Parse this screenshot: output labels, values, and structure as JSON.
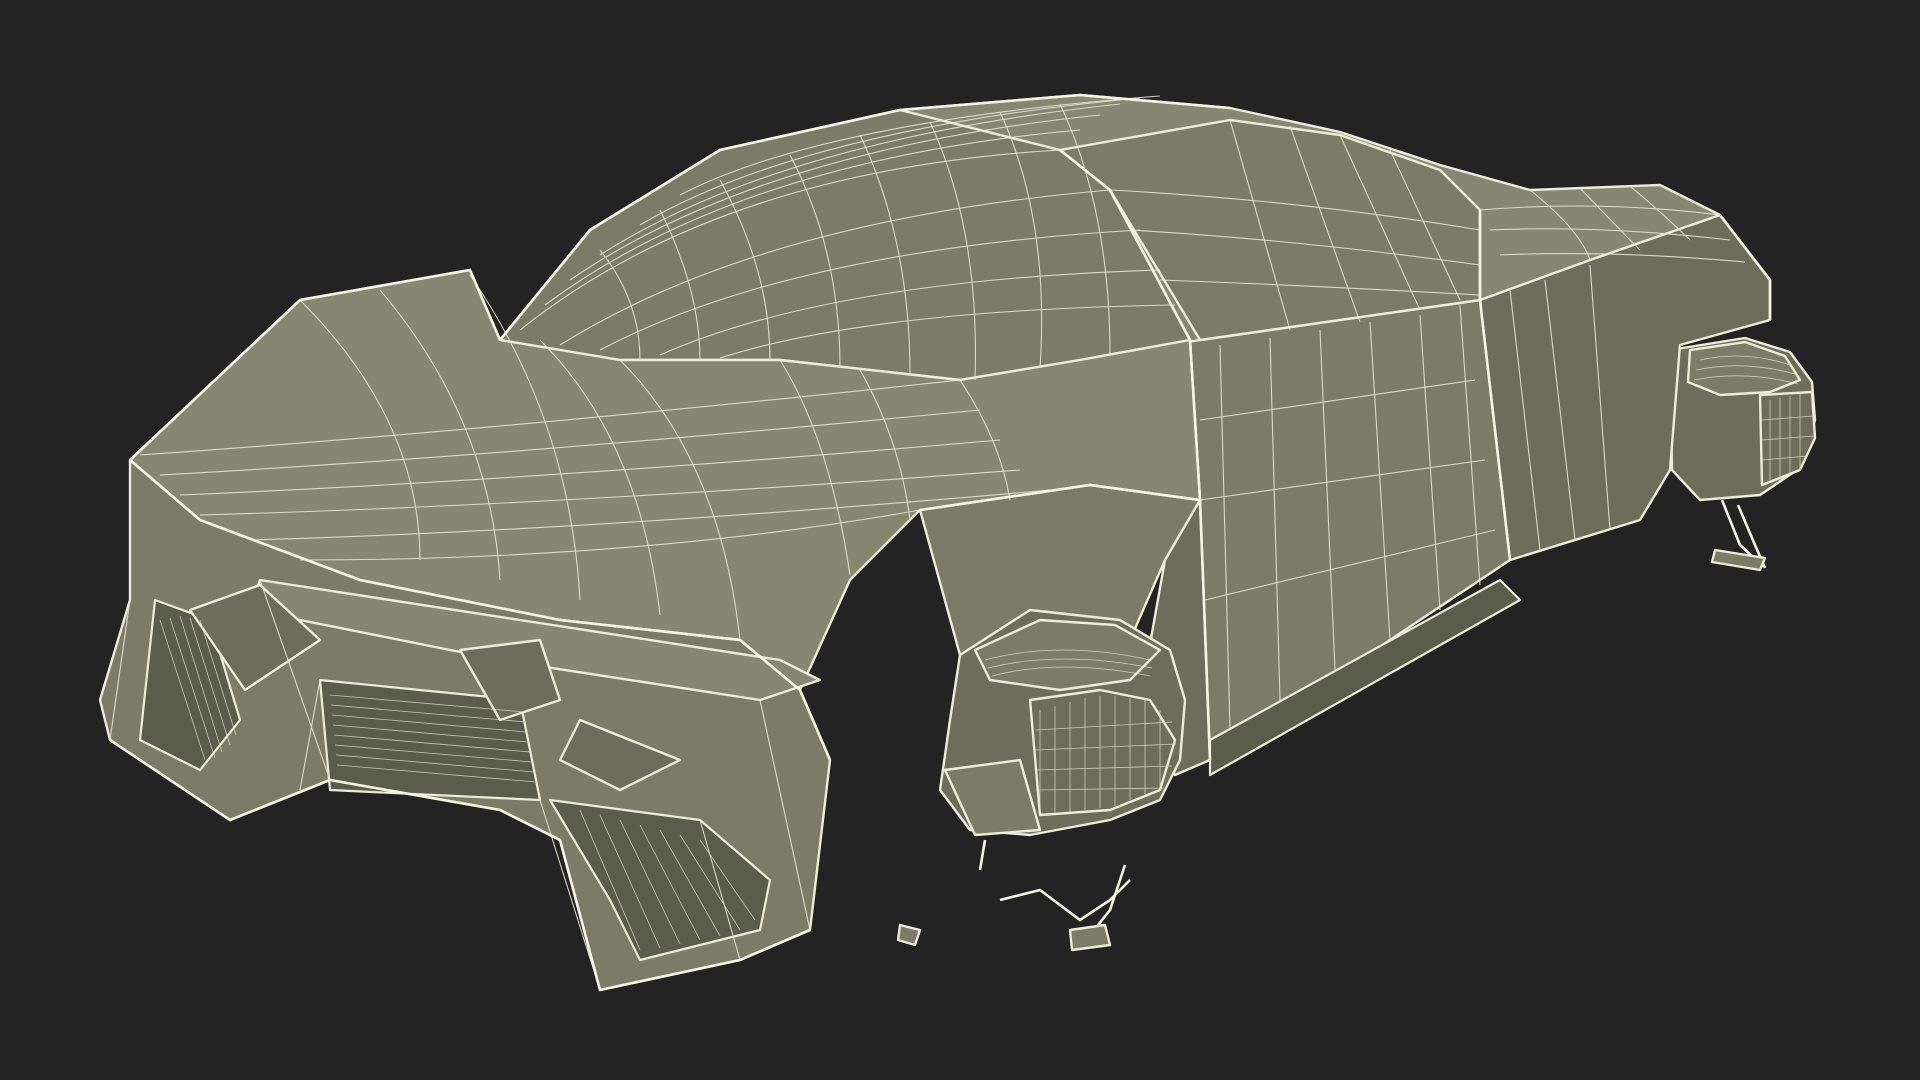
{
  "scene": {
    "subject": "wireframe-car-model",
    "colors": {
      "background": "#232323",
      "surface": "#7a7c68",
      "surface_dark": "#6c6e5b",
      "surface_deep": "#5a5c4c",
      "wire": "#ecedd8"
    }
  }
}
